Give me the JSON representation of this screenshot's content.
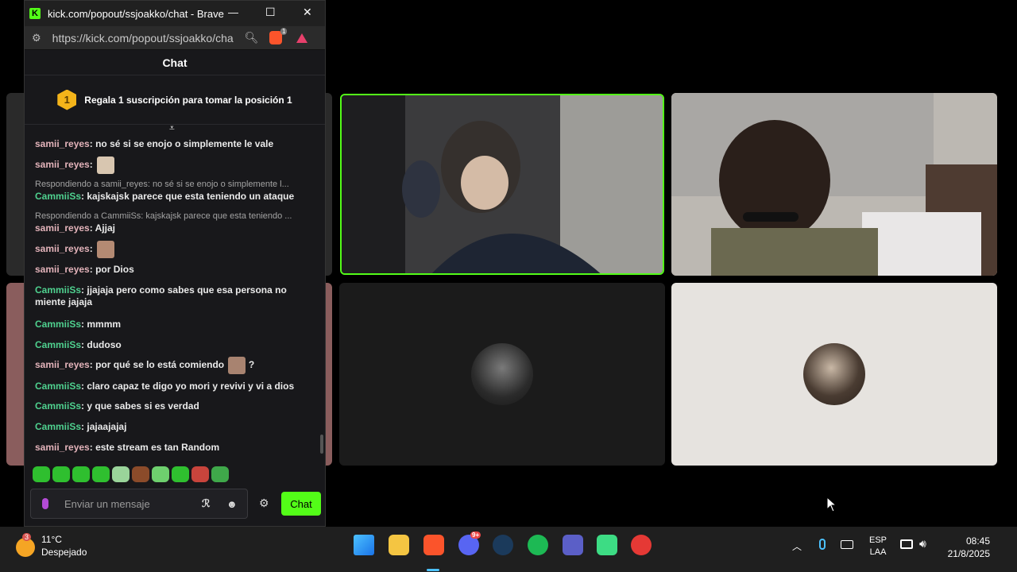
{
  "window": {
    "title": "kick.com/popout/ssjoakko/chat - Brave",
    "logo_letter": "K",
    "minimize": "—",
    "maximize": "☐",
    "close": "✕"
  },
  "addressbar": {
    "url": "https://kick.com/popout/ssjoakko/cha",
    "brave_badge": "1"
  },
  "chat": {
    "header": "Chat",
    "pinned_rank": "1",
    "pinned_text": "Regala 1 suscripción para tomar la posición 1",
    "messages": [
      {
        "user": "samii_reyes",
        "color": "#e3b3ba",
        "text": "no sé si se enojo o simplemente le vale"
      },
      {
        "user": "samii_reyes",
        "color": "#e3b3ba",
        "text": "",
        "emote": true
      },
      {
        "reply": "Respondiendo a samii_reyes: no sé si se enojo o simplemente l...",
        "user": "CammiiSs",
        "color": "#4fd18f",
        "text": "kajskajsk parece que esta teniendo un ataque"
      },
      {
        "reply": "Respondiendo a CammiiSs: kajskajsk parece que esta teniendo ...",
        "user": "samii_reyes",
        "color": "#e3b3ba",
        "text": "Ajjaj"
      },
      {
        "user": "samii_reyes",
        "color": "#e3b3ba",
        "text": "",
        "emote": true
      },
      {
        "user": "samii_reyes",
        "color": "#e3b3ba",
        "text": "por Dios"
      },
      {
        "user": "CammiiSs",
        "color": "#4fd18f",
        "text": "jjajaja pero como sabes que esa persona no miente jajaja"
      },
      {
        "user": "CammiiSs",
        "color": "#4fd18f",
        "text": "mmmm"
      },
      {
        "user": "CammiiSs",
        "color": "#4fd18f",
        "text": "dudoso"
      },
      {
        "user": "samii_reyes",
        "color": "#e3b3ba",
        "text": "por qué se lo está comiendo",
        "emote": true,
        "after": "?"
      },
      {
        "user": "CammiiSs",
        "color": "#4fd18f",
        "text": "claro capaz te digo yo mori y revivi y vi a dios"
      },
      {
        "user": "CammiiSs",
        "color": "#4fd18f",
        "text": "y que sabes si es verdad"
      },
      {
        "user": "CammiiSs",
        "color": "#4fd18f",
        "text": "jajaajajaj"
      },
      {
        "user": "samii_reyes",
        "color": "#e3b3ba",
        "text": "este stream es tan Random"
      }
    ],
    "input_placeholder": "Enviar un mensaje",
    "send_label": "Chat"
  },
  "taskbar": {
    "weather_badge": "3",
    "weather_temp": "11°C",
    "weather_desc": "Despejado",
    "discord_badge": "9+",
    "lang_1": "ESP",
    "lang_2": "LAA",
    "time": "08:45",
    "date": "21/8/2025"
  },
  "colors": {
    "kick_green": "#53fc18",
    "bg": "#18181b"
  }
}
